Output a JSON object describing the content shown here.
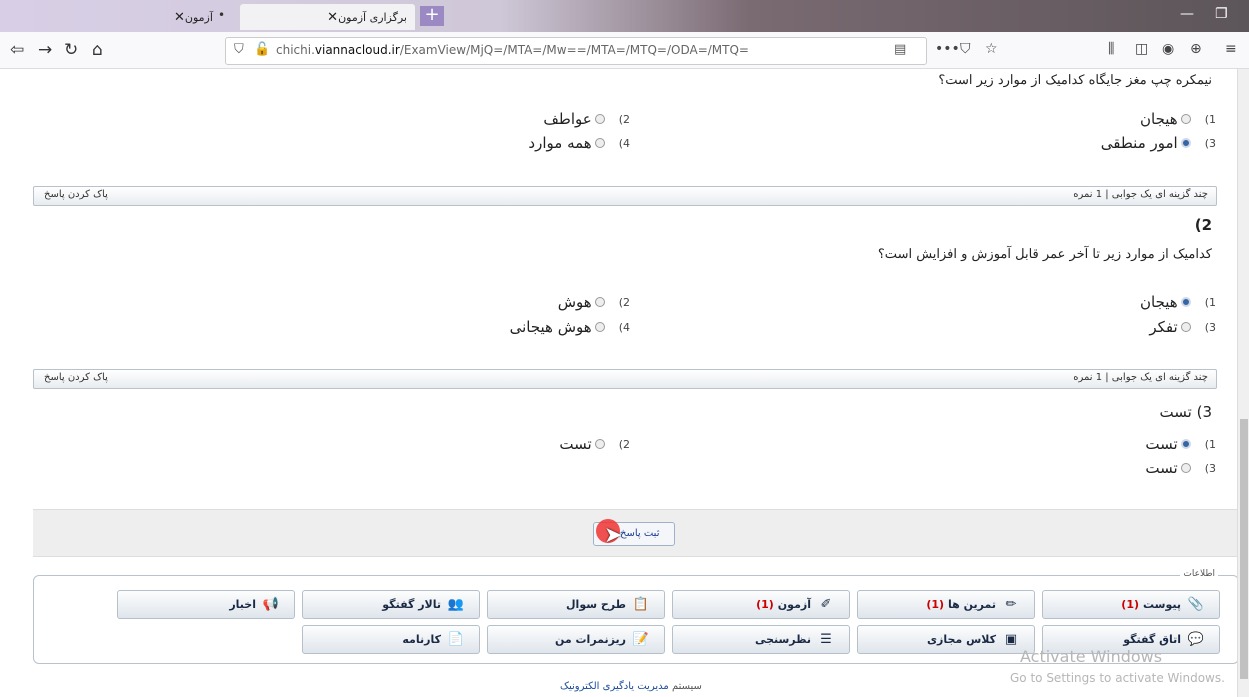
{
  "browser": {
    "tab_inactive": "آزمون",
    "tab_active": "برگزاری آزمون",
    "url_domain": "chichi.",
    "url_host": "viannacloud.ir",
    "url_path": "/ExamView/MjQ=/MTA=/Mw==/MTA=/MTQ=/ODA=/MTQ="
  },
  "q1": {
    "text": "نیمکره چپ مغز جایگاه کدامیک از موارد زیر است؟",
    "options": [
      {
        "num": "1)",
        "label": "هیجان",
        "selected": false
      },
      {
        "num": "2)",
        "label": "عواطف",
        "selected": false
      },
      {
        "num": "3)",
        "label": "امور منطقی",
        "selected": true
      },
      {
        "num": "4)",
        "label": "همه موارد",
        "selected": false
      }
    ],
    "bar_type": "چند گزینه ای یک جوابی | 1 نمره",
    "bar_clear": "پاک کردن پاسخ"
  },
  "q2": {
    "num": "2)",
    "text": "کدامیک از موارد زیر تا آخر عمر قابل آموزش و افزایش است؟",
    "options": [
      {
        "num": "1)",
        "label": "هیجان",
        "selected": true
      },
      {
        "num": "2)",
        "label": "هوش",
        "selected": false
      },
      {
        "num": "3)",
        "label": "تفکر",
        "selected": false
      },
      {
        "num": "4)",
        "label": "هوش هیجانی",
        "selected": false
      }
    ],
    "bar_type": "چند گزینه ای یک جوابی | 1 نمره",
    "bar_clear": "پاک کردن پاسخ"
  },
  "q3": {
    "title": "3) تست",
    "options": [
      {
        "num": "1)",
        "label": "تست",
        "selected": true
      },
      {
        "num": "2)",
        "label": "تست",
        "selected": false
      },
      {
        "num": "3)",
        "label": "تست",
        "selected": false
      }
    ]
  },
  "submit_label": "ثبت پاسخ ها",
  "info": {
    "legend": "اطلاعات",
    "row1": [
      {
        "label": "پیوست",
        "count": "(1)",
        "icon": "paperclip-icon"
      },
      {
        "label": "تمرین ها",
        "count": "(1)",
        "icon": "pencil-icon"
      },
      {
        "label": "آزمون",
        "count": "(1)",
        "icon": "ruler-pencil-icon"
      },
      {
        "label": "طرح سوال",
        "count": "",
        "icon": "clipboard-question-icon"
      },
      {
        "label": "تالار گفتگو",
        "count": "",
        "icon": "people-icon"
      },
      {
        "label": "اخبار",
        "count": "",
        "icon": "megaphone-icon"
      }
    ],
    "row2": [
      {
        "label": "اتاق گفتگو",
        "icon": "chat-icon"
      },
      {
        "label": "کلاس مجازی",
        "icon": "board-icon"
      },
      {
        "label": "نظرسنجی",
        "icon": "list-icon"
      },
      {
        "label": "ریزنمرات من",
        "icon": "grades-icon"
      },
      {
        "label": "کارنامه",
        "icon": "report-icon"
      }
    ]
  },
  "footer": {
    "prefix": "سیستم",
    "text": "مدیریت یادگیری الکترونیک"
  },
  "watermark": {
    "line1": "Activate Windows",
    "line2": "Go to Settings to activate Windows."
  }
}
